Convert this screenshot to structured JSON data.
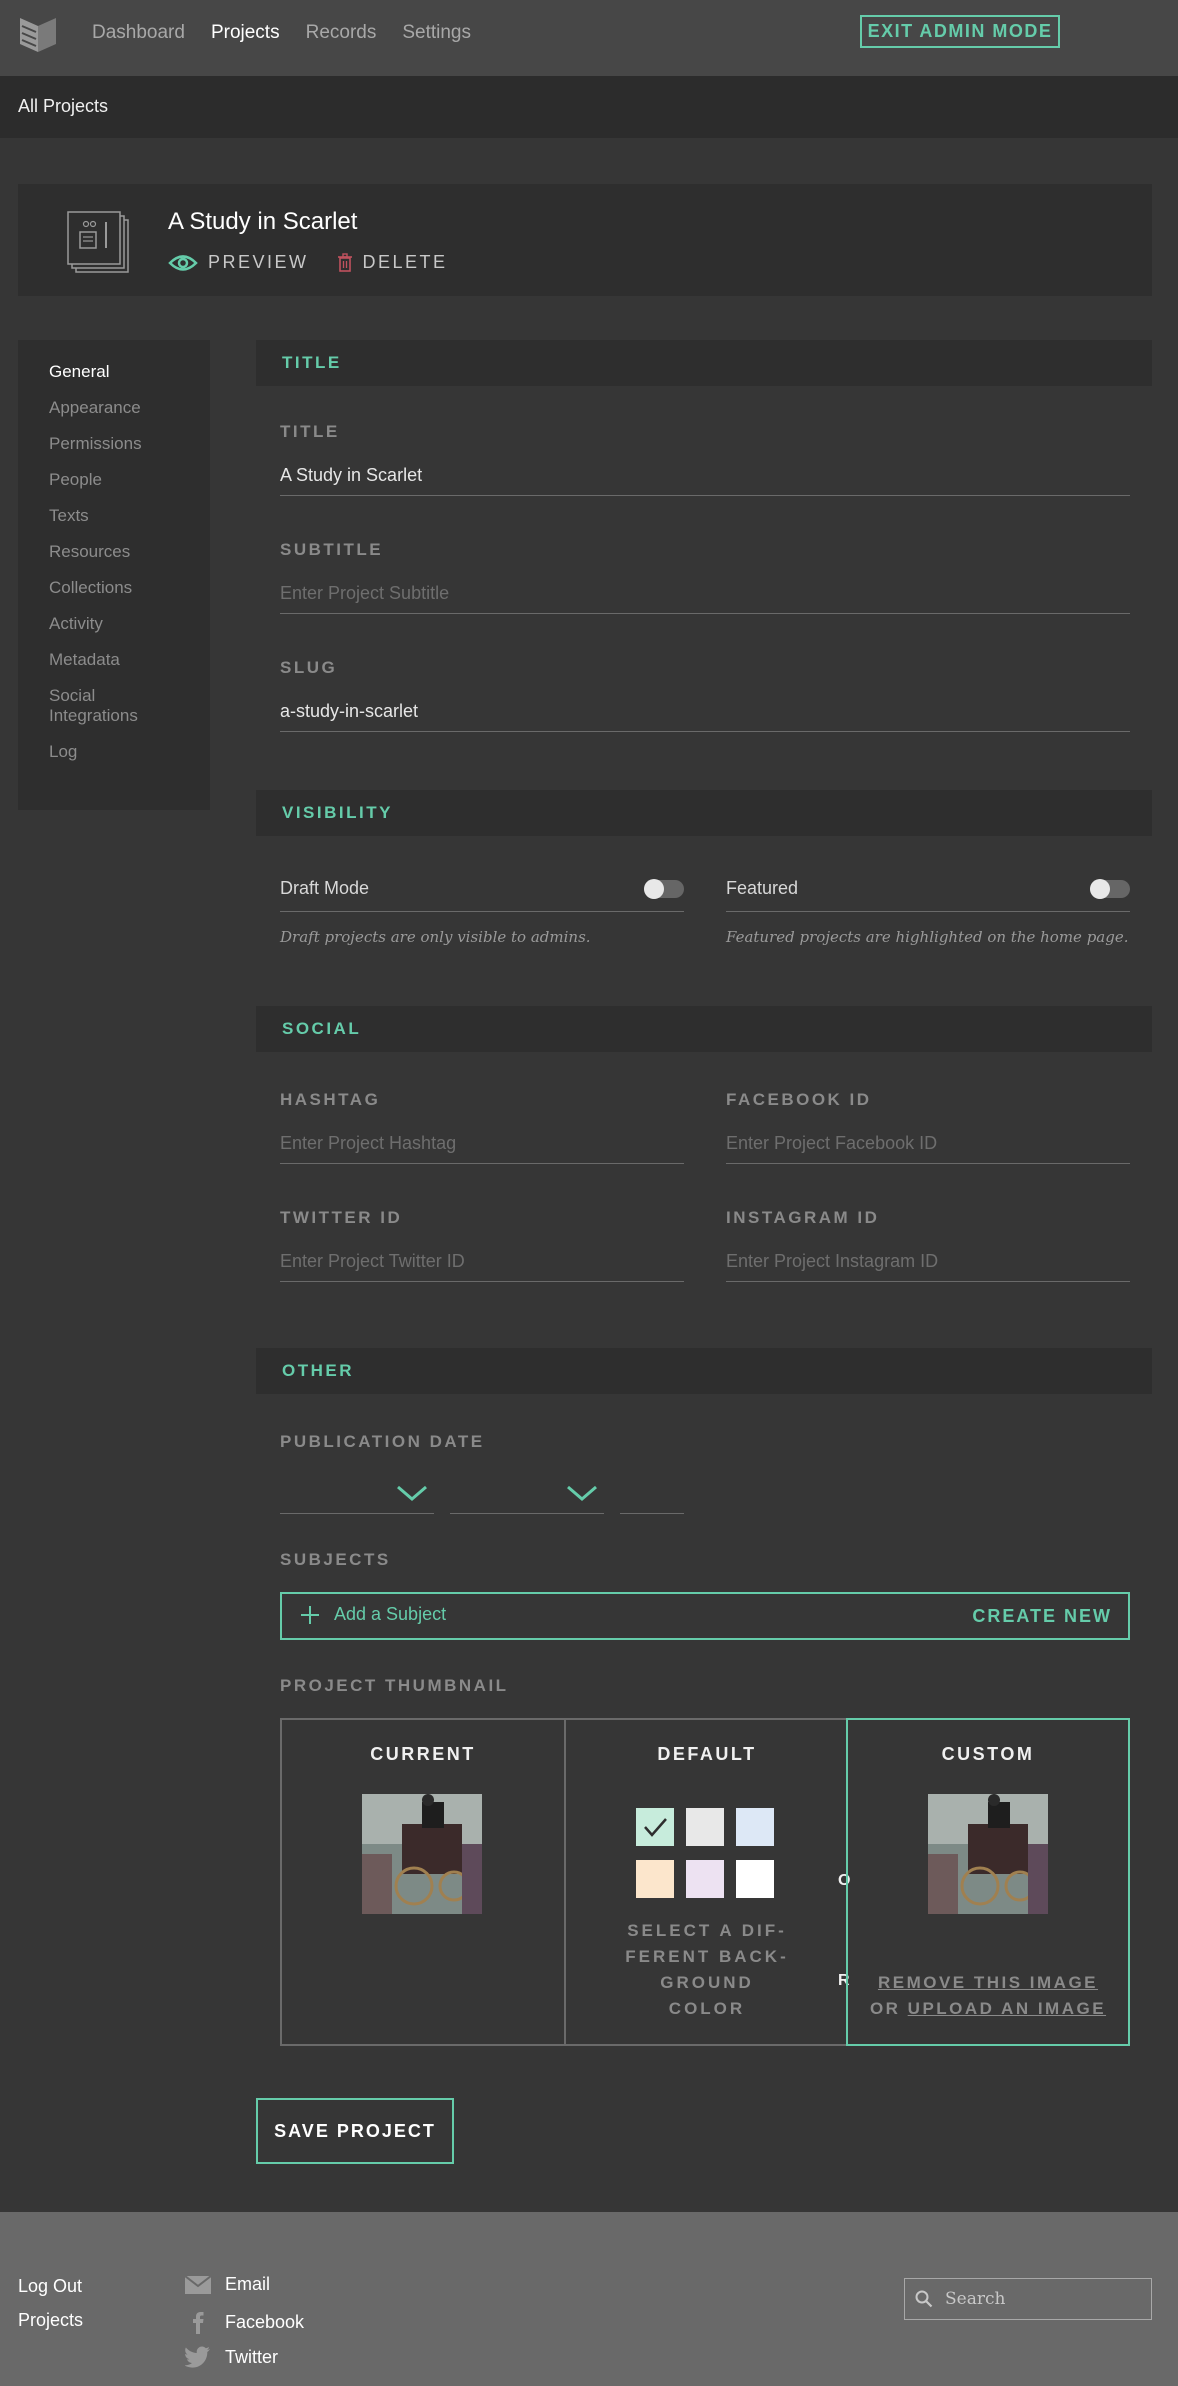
{
  "nav": {
    "items": [
      "Dashboard",
      "Projects",
      "Records",
      "Settings"
    ],
    "exit_label": "EXIT ADMIN MODE"
  },
  "breadcrumb": "All Projects",
  "project": {
    "title": "A Study in Scarlet",
    "preview_label": "PREVIEW",
    "delete_label": "DELETE"
  },
  "sidebar": {
    "items": [
      "General",
      "Appearance",
      "Permissions",
      "People",
      "Texts",
      "Resources",
      "Collections",
      "Activity",
      "Metadata",
      "Social Integrations",
      "Log"
    ],
    "active": "General"
  },
  "sections": {
    "title": {
      "header": "TITLE",
      "title_label": "TITLE",
      "title_value": "A Study in Scarlet",
      "subtitle_label": "SUBTITLE",
      "subtitle_placeholder": "Enter Project Subtitle",
      "slug_label": "SLUG",
      "slug_value": "a-study-in-scarlet"
    },
    "visibility": {
      "header": "VISIBILITY",
      "draft_label": "Draft Mode",
      "draft_on": false,
      "draft_note": "Draft projects are only visible to admins.",
      "featured_label": "Featured",
      "featured_on": false,
      "featured_note": "Featured projects are highlighted on the home page."
    },
    "social": {
      "header": "SOCIAL",
      "hashtag_label": "HASHTAG",
      "hashtag_placeholder": "Enter Project Hashtag",
      "facebook_label": "FACEBOOK ID",
      "facebook_placeholder": "Enter Project Facebook ID",
      "twitter_label": "TWITTER ID",
      "twitter_placeholder": "Enter Project Twitter ID",
      "instagram_label": "INSTAGRAM ID",
      "instagram_placeholder": "Enter Project Instagram ID"
    },
    "other": {
      "header": "OTHER",
      "pubdate_label": "PUBLICATION DATE",
      "subjects_label": "SUBJECTS",
      "add_subject": "Add a Subject",
      "create_new": "CREATE NEW",
      "thumb_label": "PROJECT THUMBNAIL",
      "current_label": "CURRENT",
      "default_label": "DEFAULT",
      "custom_label": "CUSTOM",
      "default_hint_lines": [
        "SELECT A DIF-",
        "FERENT BACK-",
        "GROUND",
        "COLOR"
      ],
      "swatches": [
        "#c7ecdc",
        "#e8e8e8",
        "#dde8f6",
        "#fce6cc",
        "#ede2f2",
        "#ffffff"
      ],
      "selected_swatch": 0,
      "remove_image": "REMOVE THIS IMAGE",
      "or_word": "OR",
      "upload_image": "UPLOAD AN IMAGE",
      "divider_or_top": "O",
      "divider_or_bottom": "R"
    }
  },
  "save_label": "SAVE PROJECT",
  "footer": {
    "links": [
      "Log Out",
      "Projects"
    ],
    "social": [
      "Email",
      "Facebook",
      "Twitter"
    ],
    "search_placeholder": "Search"
  },
  "colors": {
    "accent": "#65ccaa",
    "background": "#363636",
    "panel": "#2e2e2e",
    "delete": "#c0525e"
  }
}
